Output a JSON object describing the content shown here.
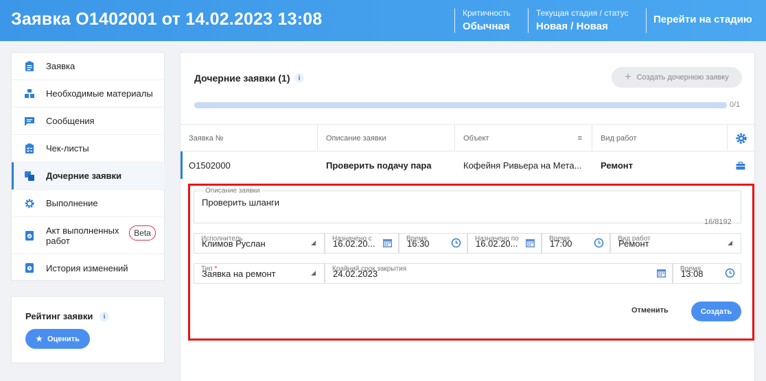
{
  "header": {
    "title": "Заявка О1402001 от 14.02.2023 13:08",
    "criticality_label": "Критичность",
    "criticality_value": "Обычная",
    "stage_label": "Текущая стадия / статус",
    "stage_value": "Новая / Новая",
    "goto_stage": "Перейти на стадию"
  },
  "sidebar": {
    "items": [
      {
        "label": "Заявка",
        "icon": "clipboard-icon"
      },
      {
        "label": "Необходимые материалы",
        "icon": "boxes-icon"
      },
      {
        "label": "Сообщения",
        "icon": "chat-icon"
      },
      {
        "label": "Чек-листы",
        "icon": "checklist-icon"
      },
      {
        "label": "Дочерние заявки",
        "icon": "child-requests-icon"
      },
      {
        "label": "Выполнение",
        "icon": "gear-icon"
      },
      {
        "label": "Акт выполненных работ",
        "icon": "document-check-icon",
        "badge": "Beta"
      },
      {
        "label": "История изменений",
        "icon": "history-icon"
      }
    ]
  },
  "rating": {
    "title": "Рейтинг заявки",
    "button": "Оценить"
  },
  "main": {
    "section_title": "Дочерние заявки (1)",
    "create_child": "Создать дочернюю заявку",
    "progress_text": "0/1",
    "progress_fraction": 1.0,
    "columns": [
      "Заявка №",
      "Описание заявки",
      "Объект",
      "Вид работ"
    ],
    "rows": [
      {
        "number": "О1502000",
        "description": "Проверить подачу пара",
        "object": "Кофейня Ривьера на Мета...",
        "work_type": "Ремонт"
      }
    ]
  },
  "form": {
    "description_label": "Описание заявки",
    "description_value": "Проверить шланги",
    "char_counter": "16/8192",
    "executor_label": "Исполнитель",
    "executor_value": "Климов Руслан",
    "assigned_from_label": "Назначено с",
    "assigned_from_value": "16.02.20...",
    "time1_label": "Время",
    "time1_value": "16:30",
    "assigned_to_label": "Назначено по",
    "assigned_to_value": "16.02.20...",
    "time2_label": "Время",
    "time2_value": "17:00",
    "work_type_label": "Вид работ",
    "work_type_value": "Ремонт",
    "type_label": "Тип",
    "type_required": "*",
    "type_value": "Заявка на ремонт",
    "deadline_label": "Крайний срок закрытия",
    "deadline_value": "24.02.2023",
    "time3_label": "Время",
    "time3_value": "13:08",
    "cancel": "Отменить",
    "create": "Создать"
  }
}
